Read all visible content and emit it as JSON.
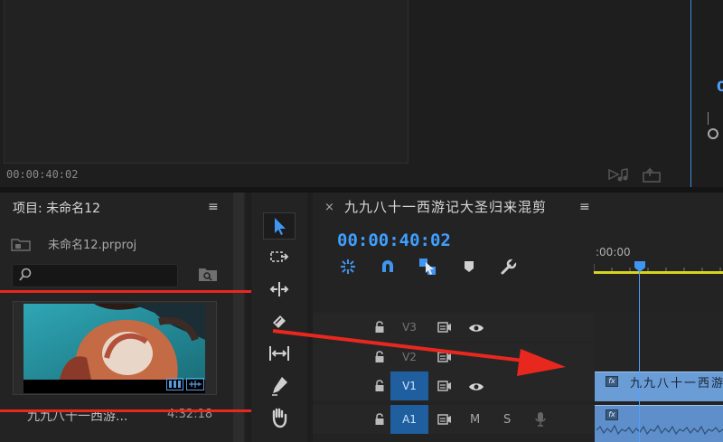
{
  "source_monitor": {
    "timecode": "00:00:40:02"
  },
  "program_monitor": {
    "partial_value": "0"
  },
  "project_panel": {
    "title": "项目: 未命名12",
    "menu_glyph": "≡",
    "project_file": "未命名12.prproj",
    "search_placeholder": "",
    "clip": {
      "name": "九九八十一西游...",
      "duration": "4:32:18"
    }
  },
  "timeline": {
    "close_glyph": "×",
    "sequence_title": "九九八十一西游记大圣归来混剪",
    "menu_glyph": "≡",
    "timecode": "00:00:40:02",
    "ruler_label": ":00:00",
    "tracks": [
      {
        "label": "V3",
        "targeted": false
      },
      {
        "label": "V2",
        "targeted": false
      },
      {
        "label": "V1",
        "targeted": true
      },
      {
        "label": "A1",
        "targeted": true,
        "mute": "M",
        "solo": "S"
      }
    ],
    "v1_clip_label": "九九八十一西游",
    "fx_label": "fx"
  },
  "icons": [
    "insert-icon",
    "export-frame-icon",
    "folder-icon",
    "search-icon",
    "new-bin-icon",
    "selection-tool-icon",
    "track-select-tool-icon",
    "ripple-edit-tool-icon",
    "razor-tool-icon",
    "slip-tool-icon",
    "pen-tool-icon",
    "hand-tool-icon",
    "nest-icon",
    "snap-icon",
    "linked-selection-icon",
    "add-marker-icon",
    "wrench-icon",
    "lock-icon",
    "sync-lock-icon",
    "eye-icon",
    "mic-icon",
    "playhead-icon"
  ],
  "colors": {
    "accent_blue": "#3fa0ff",
    "annotation_red": "#e8281e",
    "work_area_yellow": "#d8d31b",
    "clip_blue": "#6a9cd6"
  }
}
